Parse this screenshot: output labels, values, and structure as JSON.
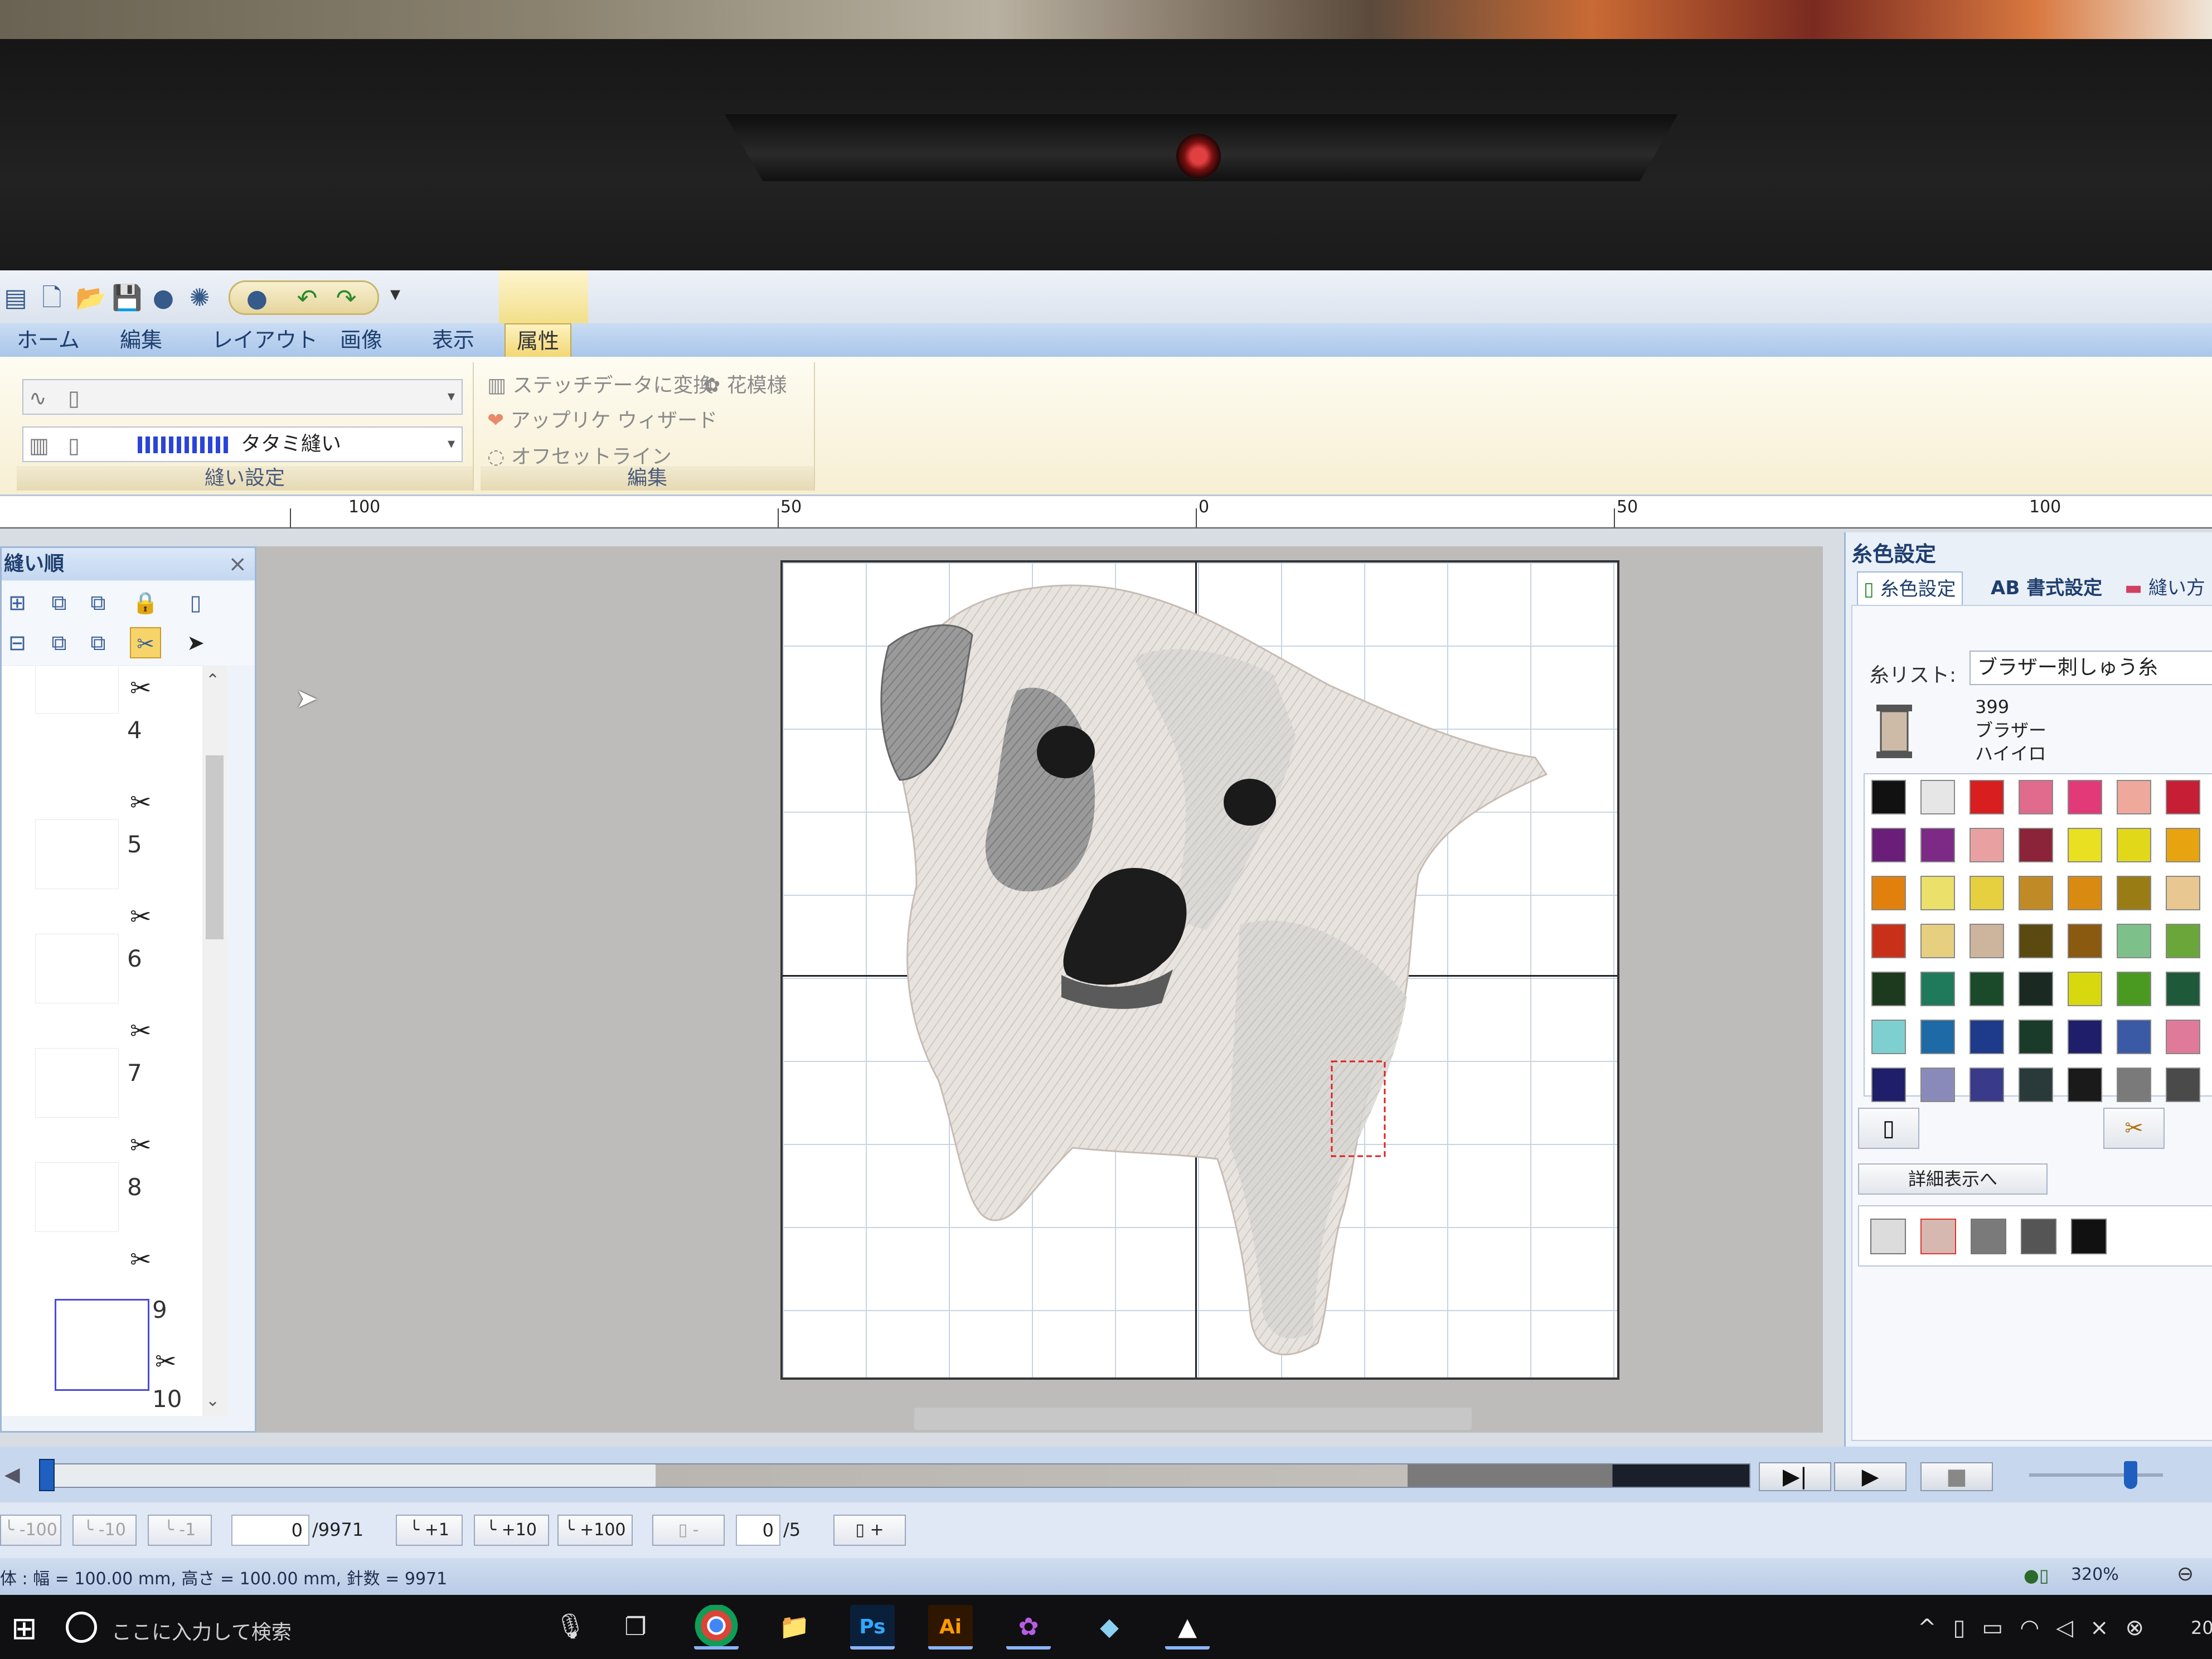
{
  "tabs": [
    "ホーム",
    "編集",
    "レイアウト",
    "画像",
    "表示",
    "属性"
  ],
  "active_tab": "属性",
  "ribbon": {
    "sew_settings": {
      "label": "縫い設定",
      "line_type": "",
      "fill_type": "タタミ縫い"
    },
    "edit": {
      "label": "編集",
      "convert_stitch": "ステッチデータに変換",
      "flower_pattern": "花模様",
      "applique_wizard": "アップリケ ウィザード",
      "offset_line": "オフセットライン"
    }
  },
  "ruler": {
    "labels": [
      "100",
      "50",
      "0",
      "50",
      "100"
    ]
  },
  "sew_order_panel": {
    "title": "縫い順",
    "items": [
      "4",
      "5",
      "6",
      "7",
      "8",
      "9",
      "10"
    ]
  },
  "thread_panel": {
    "title": "糸色設定",
    "tabs": [
      "糸色設定",
      "AB 書式設定",
      "縫い方"
    ],
    "thread_list_label": "糸リスト:",
    "thread_list_value": "ブラザー刺しゅう糸",
    "thread_number": "399",
    "thread_brand": "ブラザー",
    "thread_name": "ハイイロ",
    "detail_button": "詳細表示へ",
    "palette": [
      "#111111",
      "#e6e6e6",
      "#d81e1e",
      "#e06b8c",
      "#e23a78",
      "#eea89c",
      "#c61e34",
      "#6a1e7a",
      "#7c2a86",
      "#e9a0a0",
      "#8b2438",
      "#e8e020",
      "#e2d81a",
      "#e8a410",
      "#e2800e",
      "#eae06a",
      "#e6d040",
      "#c08a26",
      "#d98a10",
      "#9a7c14",
      "#e8c890",
      "#c8301a",
      "#e6d080",
      "#cdb49c",
      "#5a4a10",
      "#8a5a10",
      "#7ec08a",
      "#6aa63a",
      "#1e3a1e",
      "#1e7a5a",
      "#1a4a2a",
      "#1a2a22",
      "#d8d80e",
      "#4a9a22",
      "#1e5a3a",
      "#7ed0d0",
      "#1e6aa6",
      "#1e3a8a",
      "#1a3a2a",
      "#1e1e6a",
      "#3a5aa6",
      "#e07a9a",
      "#1e1e6a",
      "#8a8aba",
      "#3a3a8a",
      "#2a3a3a",
      "#1a1a1a",
      "#7a7a7a",
      "#4a4a4a"
    ],
    "used_colors": [
      "#dcdcdc",
      "#d6b8b0",
      "#7a7a7a",
      "#555555",
      "#111111"
    ]
  },
  "stitch_nav": {
    "btn_minus_100": "-100",
    "btn_minus_10": "-10",
    "btn_minus_1": "-1",
    "current_stitch": "0",
    "total_stitches": "/9971",
    "btn_plus_1": "+1",
    "btn_plus_10": "+10",
    "btn_plus_100": "+100",
    "color_minus": "-",
    "current_color": "0",
    "total_colors": "/5",
    "color_plus": "+"
  },
  "status": {
    "text": "体 : 幅 = 100.00 mm, 高さ = 100.00 mm, 針数 = 9971",
    "zoom": "320%"
  },
  "taskbar": {
    "search_placeholder": "ここに入力して検索",
    "clock": "20"
  }
}
